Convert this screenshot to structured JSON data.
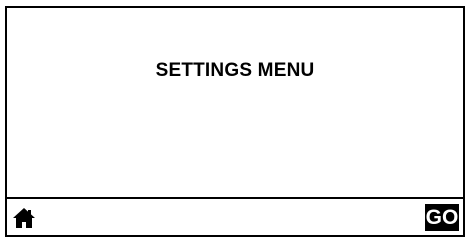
{
  "screen": {
    "title": "SETTINGS MENU"
  },
  "footer": {
    "home_icon": "home-icon",
    "go_label": "GO"
  },
  "colors": {
    "foreground": "#000000",
    "background": "#ffffff"
  }
}
